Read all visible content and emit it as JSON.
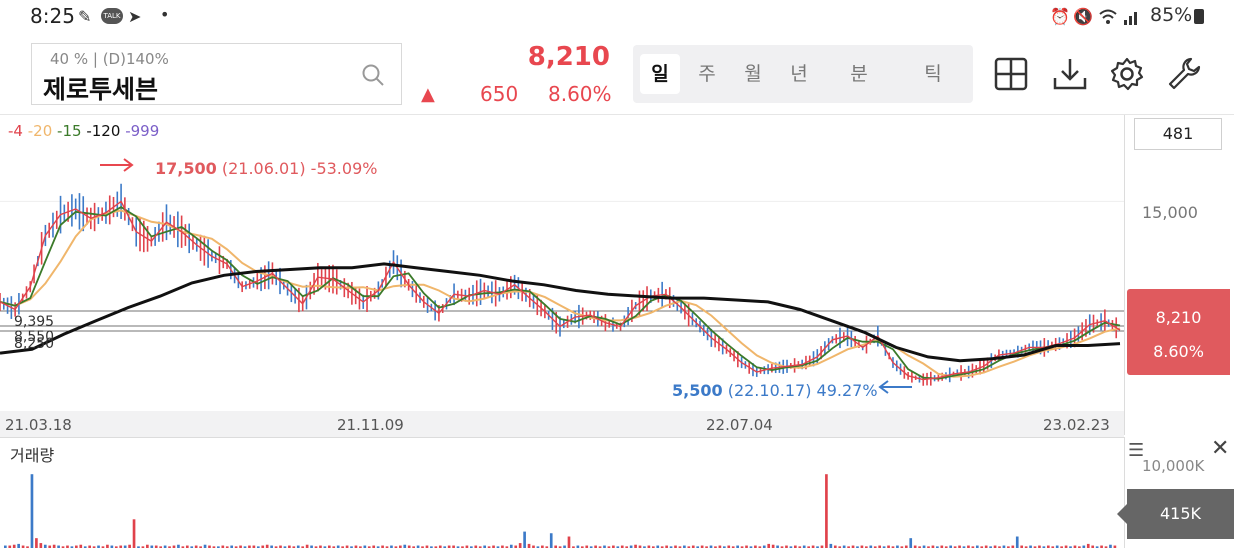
{
  "status_bar": {
    "time": "8:25",
    "talk": "TALK",
    "battery": "85%"
  },
  "header": {
    "stock_sub": "40 % | (D)140%",
    "stock_name": "제로투세븐",
    "price": "8,210",
    "up_arrow": "▲",
    "change": "650",
    "change_pct": "8.60%"
  },
  "tabs": [
    {
      "label": "일",
      "active": true
    },
    {
      "label": "주"
    },
    {
      "label": "월"
    },
    {
      "label": "년"
    },
    {
      "label": "분"
    },
    {
      "label": "틱"
    }
  ],
  "icons": [
    "grid-add-icon",
    "download-icon",
    "settings-gear-icon",
    "wrench-icon"
  ],
  "legend": [
    {
      "label": "4",
      "color": "#e0424b"
    },
    {
      "label": "20",
      "color": "#f0b66b"
    },
    {
      "label": "15",
      "color": "#3b7a2a"
    },
    {
      "label": "120",
      "color": "#111111"
    },
    {
      "label": "999",
      "color": "#7b5fc8"
    }
  ],
  "chart_data": {
    "type": "line",
    "annotations": {
      "high": {
        "value": "17,500",
        "date": "(21.06.01)",
        "pct": "-53.09%"
      },
      "low": {
        "value": "5,500",
        "date": "(22.10.17)",
        "pct": "49.27%"
      }
    },
    "left_level_labels": [
      "9,395",
      "8,550",
      "8,250"
    ],
    "x_labels": [
      "21.03.18",
      "21.11.09",
      "22.07.04",
      "23.02.23"
    ],
    "y_labels": [
      "15,000"
    ],
    "period_value": "481",
    "current_price": "8,210",
    "current_pct": "8.60%",
    "approx_close_series": [
      9700,
      9300,
      10500,
      13200,
      14300,
      14600,
      14100,
      14400,
      15000,
      13400,
      12900,
      13900,
      13400,
      12700,
      12100,
      11700,
      10500,
      10800,
      11200,
      10400,
      9600,
      11000,
      10900,
      10300,
      9700,
      10300,
      11800,
      10600,
      9700,
      9100,
      10100,
      10000,
      10300,
      10100,
      10600,
      9900,
      9200,
      8400,
      8900,
      9000,
      8600,
      8400,
      9500,
      10000,
      10100,
      9400,
      8600,
      7800,
      7200,
      6500,
      6000,
      6200,
      6300,
      6400,
      6800,
      7700,
      7900,
      7300,
      7900,
      6500,
      5800,
      5600,
      5700,
      5900,
      6000,
      6300,
      6900,
      7000,
      7300,
      7300,
      7500,
      7800,
      8500,
      8700,
      8210
    ],
    "ma120_series": [
      7000,
      7200,
      8000,
      8700,
      9400,
      10000,
      10700,
      11100,
      11300,
      11400,
      11500,
      11500,
      11700,
      11500,
      11300,
      11100,
      10800,
      10600,
      10300,
      10100,
      10000,
      9900,
      9900,
      9800,
      9700,
      9300,
      8700,
      8100,
      7300,
      6800,
      6600,
      6700,
      6900,
      7400,
      7400,
      7500
    ]
  },
  "volume": {
    "title": "거래량",
    "axis_label": "10,000K",
    "current": "415K",
    "bars": [
      3,
      3,
      4,
      5,
      3,
      2,
      90,
      12,
      6,
      4,
      3,
      4,
      3,
      2,
      3,
      2,
      3,
      4,
      2,
      3,
      2,
      3,
      2,
      4,
      3,
      2,
      3,
      3,
      4,
      35,
      2,
      2,
      4,
      3,
      3,
      2,
      3,
      2,
      3,
      4,
      2,
      3,
      2,
      3,
      2,
      4,
      3,
      2,
      2,
      3,
      2,
      3,
      2,
      3,
      2,
      3,
      3,
      2,
      3,
      4,
      3,
      2,
      3,
      2,
      3,
      2,
      3,
      2,
      4,
      3,
      2,
      3,
      2,
      3,
      2,
      3,
      2,
      3,
      2,
      3,
      2,
      3,
      2,
      3,
      2,
      3,
      2,
      3,
      2,
      3,
      4,
      3,
      2,
      3,
      2,
      3,
      2,
      2,
      3,
      2,
      3,
      3,
      2,
      2,
      3,
      2,
      3,
      2,
      3,
      2,
      3,
      2,
      3,
      2,
      4,
      3,
      6,
      20,
      5,
      3,
      2,
      3,
      2,
      18,
      3,
      2,
      3,
      14,
      2,
      3,
      2,
      3,
      2,
      3,
      2,
      3,
      2,
      3,
      2,
      3,
      2,
      3,
      4,
      3,
      2,
      3,
      2,
      3,
      2,
      3,
      2,
      3,
      2,
      3,
      2,
      3,
      2,
      3,
      2,
      3,
      2,
      3,
      2,
      3,
      2,
      3,
      2,
      3,
      2,
      3,
      2,
      3,
      5,
      4,
      3,
      2,
      3,
      2,
      3,
      2,
      3,
      2,
      3,
      2,
      3,
      90,
      5,
      3,
      2,
      3,
      2,
      3,
      2,
      3,
      2,
      3,
      2,
      3,
      2,
      3,
      2,
      3,
      2,
      3,
      12,
      3,
      2,
      3,
      2,
      3,
      2,
      3,
      2,
      3,
      2,
      3,
      2,
      3,
      2,
      3,
      2,
      3,
      2,
      3,
      2,
      3,
      2,
      3,
      14,
      3,
      2,
      3,
      2,
      3,
      2,
      3,
      2,
      3,
      2,
      3,
      2,
      3,
      2,
      3,
      5,
      3,
      2,
      3,
      2,
      4,
      3
    ]
  }
}
